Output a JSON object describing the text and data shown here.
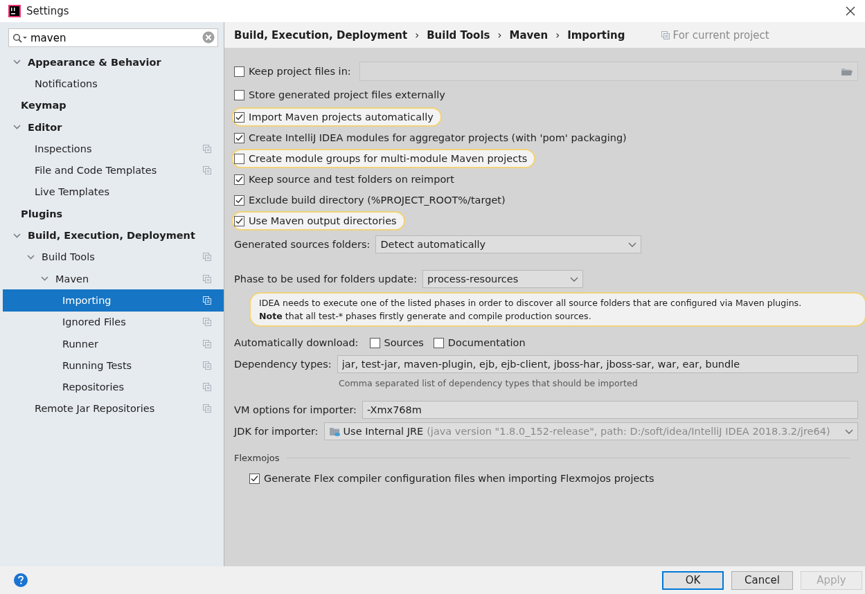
{
  "window": {
    "title": "Settings"
  },
  "search": {
    "value": "maven"
  },
  "sidebar": {
    "items": [
      {
        "label": "Appearance & Behavior",
        "selected": false,
        "expanded": true,
        "project_level": false,
        "children": [
          {
            "label": "Notifications",
            "selected": false,
            "project_level": false
          }
        ]
      },
      {
        "label": "Keymap",
        "selected": false,
        "project_level": false
      },
      {
        "label": "Editor",
        "selected": false,
        "expanded": true,
        "project_level": false,
        "children": [
          {
            "label": "Inspections",
            "selected": false,
            "project_level": true
          },
          {
            "label": "File and Code Templates",
            "selected": false,
            "project_level": true
          },
          {
            "label": "Live Templates",
            "selected": false,
            "project_level": false
          }
        ]
      },
      {
        "label": "Plugins",
        "selected": false,
        "project_level": false
      },
      {
        "label": "Build, Execution, Deployment",
        "selected": false,
        "expanded": true,
        "project_level": false,
        "children": [
          {
            "label": "Build Tools",
            "selected": false,
            "expanded": true,
            "project_level": true,
            "children": [
              {
                "label": "Maven",
                "selected": false,
                "expanded": true,
                "project_level": true,
                "children": [
                  {
                    "label": "Importing",
                    "selected": true,
                    "project_level": true
                  },
                  {
                    "label": "Ignored Files",
                    "selected": false,
                    "project_level": true
                  },
                  {
                    "label": "Runner",
                    "selected": false,
                    "project_level": true
                  },
                  {
                    "label": "Running Tests",
                    "selected": false,
                    "project_level": true
                  },
                  {
                    "label": "Repositories",
                    "selected": false,
                    "project_level": true
                  }
                ]
              }
            ]
          },
          {
            "label": "Remote Jar Repositories",
            "selected": false,
            "project_level": true
          }
        ]
      }
    ]
  },
  "breadcrumb": {
    "items": [
      "Build, Execution, Deployment",
      "Build Tools",
      "Maven",
      "Importing"
    ],
    "separator": "›",
    "scope": "For current project"
  },
  "rows": [
    {
      "kind": "checkbox_field",
      "label": "Keep project files in:",
      "checked": false,
      "highlighted": false
    },
    {
      "kind": "checkbox",
      "label": "Store generated project files externally",
      "checked": false,
      "highlighted": false
    },
    {
      "kind": "checkbox",
      "label": "Import Maven projects automatically",
      "checked": true,
      "highlighted": true
    },
    {
      "kind": "checkbox",
      "label": "Create IntelliJ IDEA modules for aggregator projects (with 'pom' packaging)",
      "checked": true,
      "highlighted": false
    },
    {
      "kind": "checkbox",
      "label": "Create module groups for multi-module Maven projects",
      "checked": false,
      "highlighted": true
    },
    {
      "kind": "checkbox",
      "label": "Keep source and test folders on reimport",
      "checked": true,
      "highlighted": false
    },
    {
      "kind": "checkbox",
      "label": "Exclude build directory (%PROJECT_ROOT%/target)",
      "checked": true,
      "highlighted": false
    },
    {
      "kind": "checkbox",
      "label": "Use Maven output directories",
      "checked": true,
      "highlighted": true
    },
    {
      "kind": "select",
      "label": "Generated sources folders:",
      "value": "Detect automatically",
      "wide": true
    },
    {
      "kind": "select",
      "label": "Phase to be used for folders update:",
      "value": "process-resources",
      "wide": false
    },
    {
      "kind": "note",
      "lines": [
        "IDEA needs to execute one of the listed phases in order to discover all source folders that are configured via Maven plugins.",
        "**Note** that all test-* phases firstly generate and compile production sources."
      ]
    },
    {
      "kind": "checkbox_group",
      "label": "Automatically download:",
      "options": [
        {
          "label": "Sources",
          "checked": false
        },
        {
          "label": "Documentation",
          "checked": false
        }
      ]
    },
    {
      "kind": "text_field",
      "label": "Dependency types:",
      "value": "jar, test-jar, maven-plugin, ejb, ejb-client, jboss-har, jboss-sar, war, ear, bundle"
    },
    {
      "kind": "hint",
      "text": "Comma separated list of dependency types that should be imported"
    },
    {
      "kind": "text_field",
      "label": "VM options for importer:",
      "value": "-Xmx768m"
    },
    {
      "kind": "jdk_select",
      "label": "JDK for importer:",
      "name": "Use Internal JRE",
      "detail": "(java version \"1.8.0_152-release\", path: D:/soft/idea/IntelliJ IDEA 2018.3.2/jre64)"
    },
    {
      "kind": "group_header",
      "label": "Flexmojos"
    },
    {
      "kind": "checkbox",
      "label": "Generate Flex compiler configuration files when importing Flexmojos projects",
      "checked": true,
      "highlighted": false,
      "indented": true
    }
  ],
  "buttons": [
    {
      "label": "OK",
      "kind": "default"
    },
    {
      "label": "Cancel",
      "kind": "normal"
    },
    {
      "label": "Apply",
      "kind": "disabled"
    }
  ]
}
